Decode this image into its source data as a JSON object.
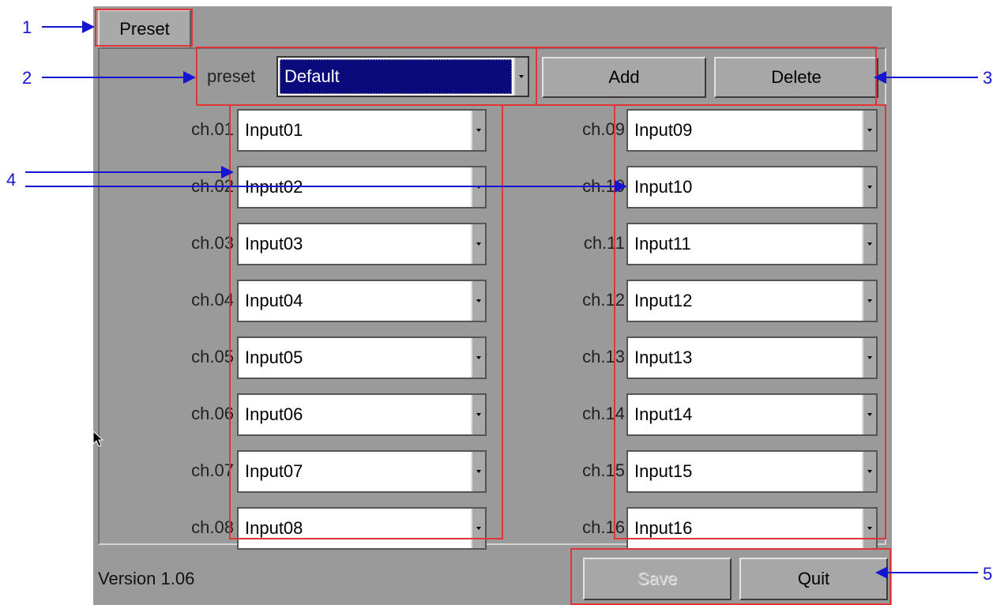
{
  "tab": {
    "label": "Preset"
  },
  "preset": {
    "label": "preset",
    "value": "Default"
  },
  "buttons": {
    "add": "Add",
    "delete": "Delete",
    "save": "Save",
    "quit": "Quit"
  },
  "version": "Version 1.06",
  "channels_left": [
    {
      "label": "ch.01",
      "value": "Input01"
    },
    {
      "label": "ch.02",
      "value": "Input02"
    },
    {
      "label": "ch.03",
      "value": "Input03"
    },
    {
      "label": "ch.04",
      "value": "Input04"
    },
    {
      "label": "ch.05",
      "value": "Input05"
    },
    {
      "label": "ch.06",
      "value": "Input06"
    },
    {
      "label": "ch.07",
      "value": "Input07"
    },
    {
      "label": "ch.08",
      "value": "Input08"
    }
  ],
  "channels_right": [
    {
      "label": "ch.09",
      "value": "Input09"
    },
    {
      "label": "ch.10",
      "value": "Input10"
    },
    {
      "label": "ch.11",
      "value": "Input11"
    },
    {
      "label": "ch.12",
      "value": "Input12"
    },
    {
      "label": "ch.13",
      "value": "Input13"
    },
    {
      "label": "ch.14",
      "value": "Input14"
    },
    {
      "label": "ch.15",
      "value": "Input15"
    },
    {
      "label": "ch.16",
      "value": "Input16"
    }
  ],
  "callouts": {
    "c1": "1",
    "c2": "2",
    "c3": "3",
    "c4": "4",
    "c5": "5"
  },
  "colors": {
    "panel": "#9a9a9a",
    "highlight": "#e23434",
    "callout": "#1414d2",
    "selection": "#0a0a7d"
  }
}
